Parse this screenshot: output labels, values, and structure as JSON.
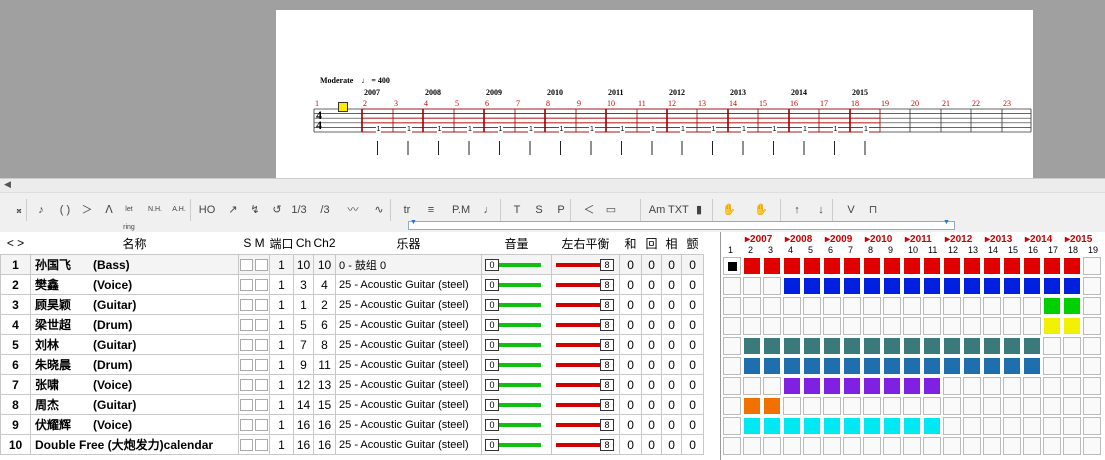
{
  "score": {
    "tempo_label": "Moderate",
    "tempo_value": "= 400",
    "time_sig_top": "4",
    "time_sig_bottom": "4",
    "year_labels": [
      "2007",
      "2008",
      "2009",
      "2010",
      "2011",
      "2012",
      "2013",
      "2014",
      "2015"
    ],
    "measure_numbers": [
      "1",
      "2",
      "3",
      "4",
      "5",
      "6",
      "7",
      "8",
      "9",
      "10",
      "11",
      "12",
      "13",
      "14",
      "15",
      "16",
      "17",
      "18",
      "19",
      "20",
      "21",
      "22",
      "23"
    ],
    "tab_fret": "1"
  },
  "toolbar": {
    "items": [
      "𝄪",
      "♪",
      "( )",
      "＞",
      "ᐱ",
      "let ring",
      "N.H.",
      "A.H.",
      "HO",
      "↗",
      "↯",
      "↺",
      "1/3",
      "/3",
      "〰",
      "∿",
      "tr",
      "≡",
      "P.M",
      "♩",
      "T",
      "S",
      "P",
      "＜",
      "▭",
      "Am",
      "TXT",
      "▮",
      "✋",
      "✋",
      "↑",
      "↓",
      "V",
      "⊓"
    ]
  },
  "tracks": {
    "headers": {
      "nav": "< >",
      "name": "名称",
      "s": "S",
      "m": "M",
      "port": "端口",
      "ch": "Ch",
      "ch2": "Ch2",
      "instrument": "乐器",
      "volume": "音量",
      "balance": "左右平衡",
      "chorus": "和",
      "reverb": "回",
      "phase": "相",
      "tremolo": "颤"
    },
    "rows": [
      {
        "num": "1",
        "name": "孙国飞",
        "type": "(Bass)",
        "port": "1",
        "ch": "10",
        "ch2": "10",
        "instrument": "0 - 鼓组 0",
        "vol": "0",
        "bal": "8",
        "c": "0",
        "r": "0",
        "p": "0",
        "t": "0"
      },
      {
        "num": "2",
        "name": "樊鑫",
        "type": "(Voice)",
        "port": "1",
        "ch": "3",
        "ch2": "4",
        "instrument": "25 - Acoustic Guitar (steel)",
        "vol": "0",
        "bal": "8",
        "c": "0",
        "r": "0",
        "p": "0",
        "t": "0"
      },
      {
        "num": "3",
        "name": "顾昊颖",
        "type": "(Guitar)",
        "port": "1",
        "ch": "1",
        "ch2": "2",
        "instrument": "25 - Acoustic Guitar (steel)",
        "vol": "0",
        "bal": "8",
        "c": "0",
        "r": "0",
        "p": "0",
        "t": "0"
      },
      {
        "num": "4",
        "name": "梁世超",
        "type": "(Drum)",
        "port": "1",
        "ch": "5",
        "ch2": "6",
        "instrument": "25 - Acoustic Guitar (steel)",
        "vol": "0",
        "bal": "8",
        "c": "0",
        "r": "0",
        "p": "0",
        "t": "0"
      },
      {
        "num": "5",
        "name": "刘林",
        "type": "(Guitar)",
        "port": "1",
        "ch": "7",
        "ch2": "8",
        "instrument": "25 - Acoustic Guitar (steel)",
        "vol": "0",
        "bal": "8",
        "c": "0",
        "r": "0",
        "p": "0",
        "t": "0"
      },
      {
        "num": "6",
        "name": "朱晓晨",
        "type": "(Drum)",
        "port": "1",
        "ch": "9",
        "ch2": "11",
        "instrument": "25 - Acoustic Guitar (steel)",
        "vol": "0",
        "bal": "8",
        "c": "0",
        "r": "0",
        "p": "0",
        "t": "0"
      },
      {
        "num": "7",
        "name": "张啸",
        "type": "(Voice)",
        "port": "1",
        "ch": "12",
        "ch2": "13",
        "instrument": "25 - Acoustic Guitar (steel)",
        "vol": "0",
        "bal": "8",
        "c": "0",
        "r": "0",
        "p": "0",
        "t": "0"
      },
      {
        "num": "8",
        "name": "周杰",
        "type": "(Guitar)",
        "port": "1",
        "ch": "14",
        "ch2": "15",
        "instrument": "25 - Acoustic Guitar (steel)",
        "vol": "0",
        "bal": "8",
        "c": "0",
        "r": "0",
        "p": "0",
        "t": "0"
      },
      {
        "num": "9",
        "name": "伏耀辉",
        "type": "(Voice)",
        "port": "1",
        "ch": "16",
        "ch2": "16",
        "instrument": "25 - Acoustic Guitar (steel)",
        "vol": "0",
        "bal": "8",
        "c": "0",
        "r": "0",
        "p": "0",
        "t": "0"
      },
      {
        "num": "10",
        "name": "Double Free (大炮发力)calendar",
        "type": "",
        "port": "1",
        "ch": "16",
        "ch2": "16",
        "instrument": "25 - Acoustic Guitar (steel)",
        "vol": "0",
        "bal": "8",
        "c": "0",
        "r": "0",
        "p": "0",
        "t": "0"
      }
    ]
  },
  "timeline": {
    "years": [
      {
        "label": "2007",
        "col": 2
      },
      {
        "label": "2008",
        "col": 4
      },
      {
        "label": "2009",
        "col": 6
      },
      {
        "label": "2010",
        "col": 8
      },
      {
        "label": "2011",
        "col": 10
      },
      {
        "label": "2012",
        "col": 12
      },
      {
        "label": "2013",
        "col": 14
      },
      {
        "label": "2014",
        "col": 16
      },
      {
        "label": "2015",
        "col": 18
      }
    ],
    "columns": [
      "1",
      "2",
      "3",
      "4",
      "5",
      "6",
      "7",
      "8",
      "9",
      "10",
      "11",
      "12",
      "13",
      "14",
      "15",
      "16",
      "17",
      "18",
      "19"
    ],
    "bars": [
      {
        "row": 0,
        "start": 2,
        "end": 18,
        "color": "#e00000"
      },
      {
        "row": 1,
        "start": 4,
        "end": 18,
        "color": "#0020e0"
      },
      {
        "row": 2,
        "start": 17,
        "end": 18,
        "color": "#00d000"
      },
      {
        "row": 3,
        "start": 17,
        "end": 18,
        "color": "#f0f000"
      },
      {
        "row": 4,
        "start": 2,
        "end": 16,
        "color": "#3a7a7a"
      },
      {
        "row": 5,
        "start": 2,
        "end": 16,
        "color": "#1f6fae"
      },
      {
        "row": 6,
        "start": 4,
        "end": 11,
        "color": "#8020e0"
      },
      {
        "row": 7,
        "start": 2,
        "end": 3,
        "color": "#f07000"
      },
      {
        "row": 8,
        "start": 2,
        "end": 11,
        "color": "#00e8f0"
      }
    ],
    "cursor_color": "#000000"
  }
}
